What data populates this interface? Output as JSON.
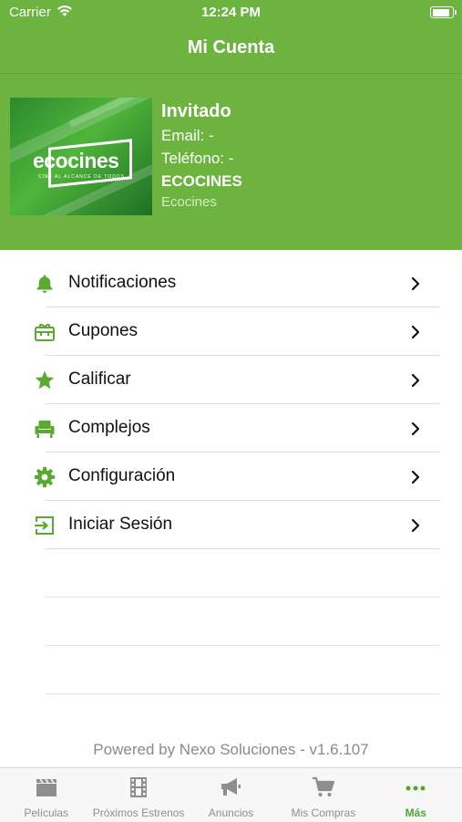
{
  "status_bar": {
    "carrier": "Carrier",
    "time": "12:24 PM"
  },
  "navbar": {
    "title": "Mi Cuenta"
  },
  "profile": {
    "logo_text": "ecocines",
    "logo_tagline": "CINE AL ALCANCE DE TODOS",
    "name": "Invitado",
    "email": "Email: -",
    "phone": "Teléfono: -",
    "company": "ECOCINES",
    "company_sub": "Ecocines"
  },
  "menu": {
    "items": [
      {
        "label": "Notificaciones",
        "icon": "bell-icon"
      },
      {
        "label": "Cupones",
        "icon": "gift-icon"
      },
      {
        "label": "Calificar",
        "icon": "star-icon"
      },
      {
        "label": "Complejos",
        "icon": "armchair-icon"
      },
      {
        "label": "Configuración",
        "icon": "gear-icon"
      },
      {
        "label": "Iniciar Sesión",
        "icon": "sign-in-icon"
      }
    ]
  },
  "footer": {
    "powered": "Powered by Nexo Soluciones - v1.6.107"
  },
  "tabbar": {
    "tabs": [
      {
        "label": "Películas",
        "icon": "clapperboard-icon"
      },
      {
        "label": "Próximos Estrenos",
        "icon": "film-strip-icon"
      },
      {
        "label": "Anuncios",
        "icon": "megaphone-icon"
      },
      {
        "label": "Mis Compras",
        "icon": "cart-icon"
      },
      {
        "label": "Más",
        "icon": "more-dots-icon"
      }
    ],
    "active_index": 4
  },
  "colors": {
    "brand": "#6cb33f",
    "icon_green": "#5aaa32",
    "active_tab": "#4fa632"
  }
}
